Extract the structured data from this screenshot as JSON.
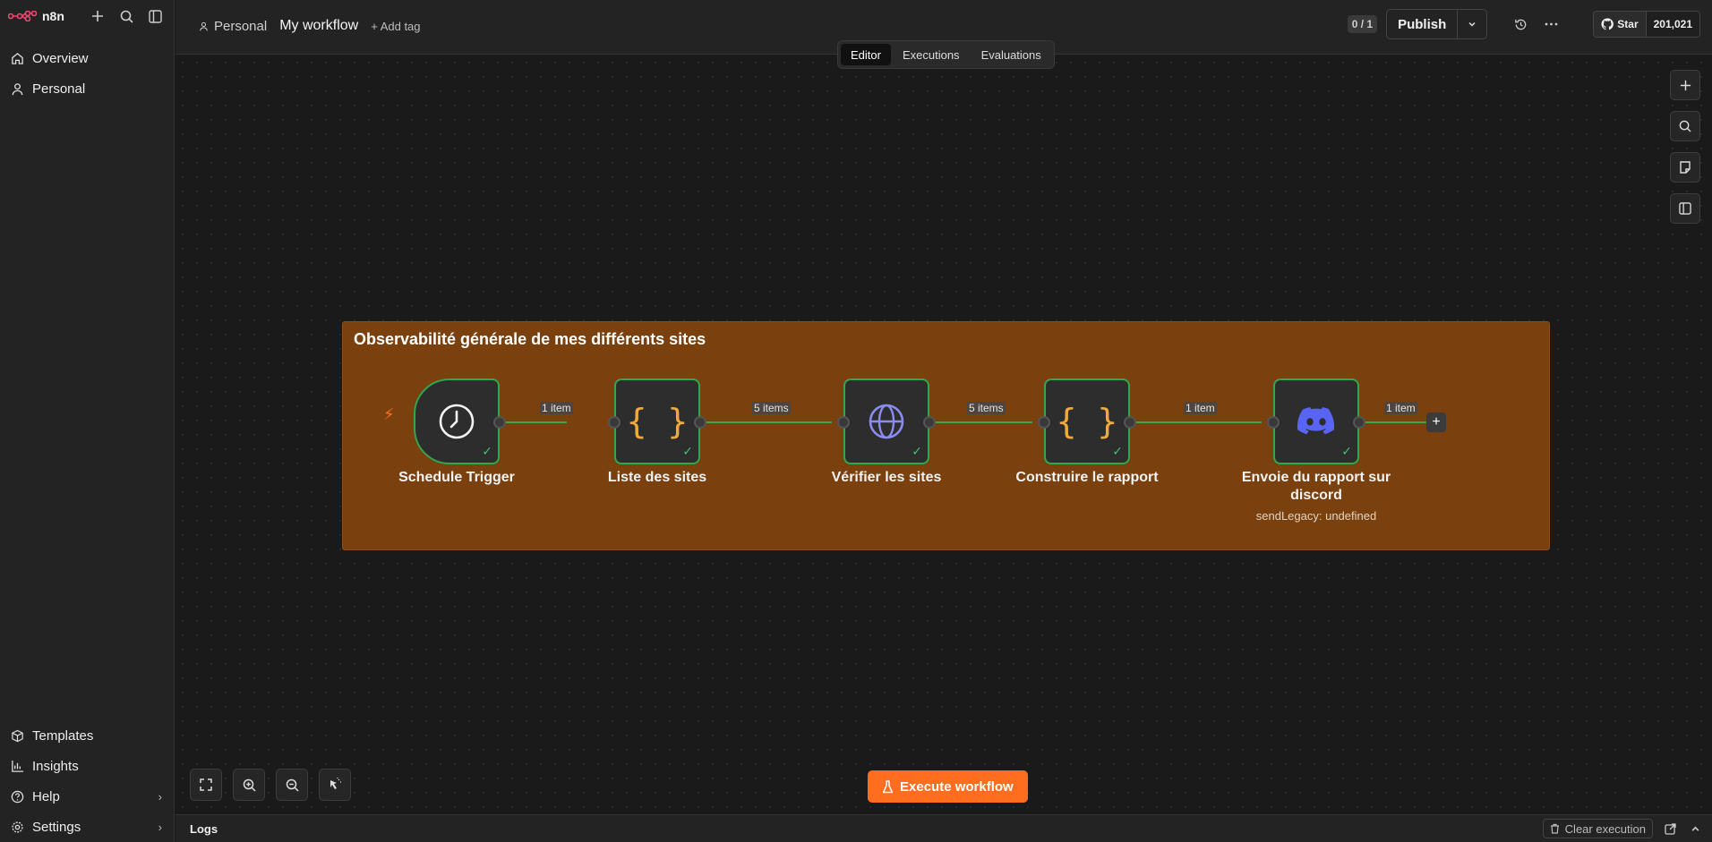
{
  "app": {
    "name": "n8n",
    "brand_color": "#ea4b71",
    "accent": "#ff6d1f"
  },
  "sidebar": {
    "top_items": [
      {
        "label": "Overview",
        "icon": "home-icon"
      },
      {
        "label": "Personal",
        "icon": "user-icon"
      }
    ],
    "bottom_items": [
      {
        "label": "Templates",
        "icon": "box-icon"
      },
      {
        "label": "Insights",
        "icon": "bar-chart-icon"
      },
      {
        "label": "Help",
        "icon": "help-circle-icon"
      },
      {
        "label": "Settings",
        "icon": "gear-icon"
      }
    ]
  },
  "header": {
    "project": "Personal",
    "workflow_name": "My workflow",
    "add_tag": "+ Add tag",
    "counter": "0 / 1",
    "publish": "Publish",
    "github": {
      "star": "Star",
      "count": "201,021"
    }
  },
  "tabs": [
    "Editor",
    "Executions",
    "Evaluations"
  ],
  "sticky": {
    "title": "Observabilité générale de mes différents sites"
  },
  "nodes": [
    {
      "label": "Schedule Trigger",
      "icon": "clock-icon",
      "status": "success"
    },
    {
      "label": "Liste des sites",
      "icon": "code-braces-icon",
      "status": "success"
    },
    {
      "label": "Vérifier les sites",
      "icon": "globe-icon",
      "status": "success"
    },
    {
      "label": "Construire le rapport",
      "icon": "code-braces-icon",
      "status": "success"
    },
    {
      "label": "Envoie du rapport sur discord",
      "subtitle": "sendLegacy: undefined",
      "icon": "discord-icon",
      "status": "success"
    }
  ],
  "edges": [
    "1 item",
    "5 items",
    "5 items",
    "1 item",
    "1 item"
  ],
  "canvas": {
    "execute_button": "Execute workflow"
  },
  "logs": {
    "title": "Logs",
    "clear_button": "Clear execution"
  }
}
